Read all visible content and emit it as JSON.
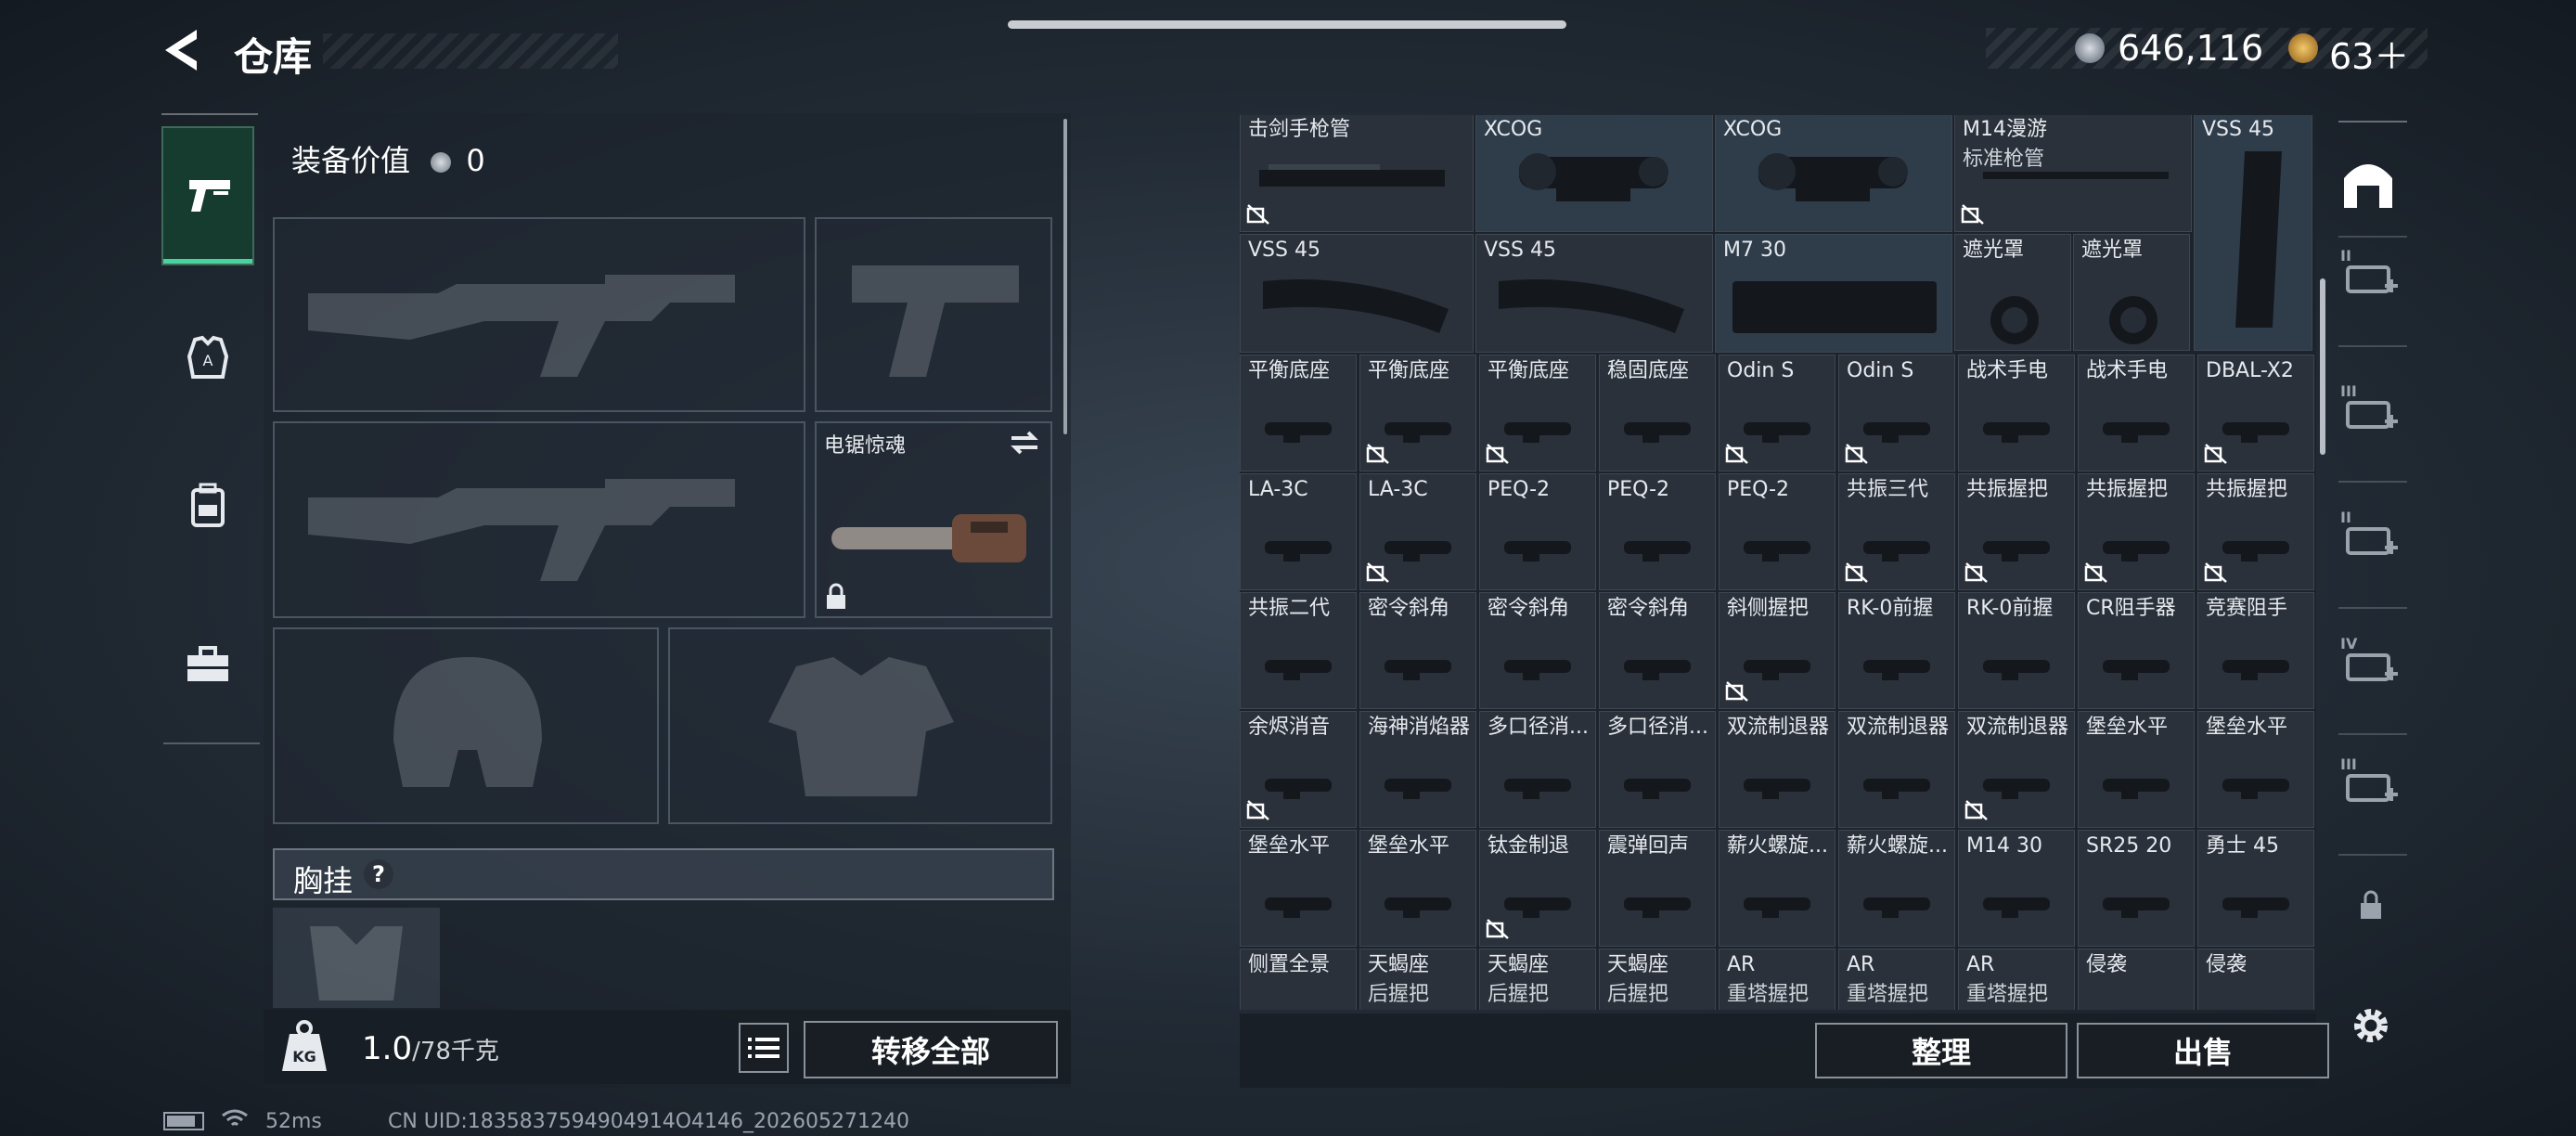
{
  "header": {
    "title": "仓库",
    "currency_1": "646,116",
    "currency_2": "63＋"
  },
  "left_tabs": [
    {
      "icon": "pistol-icon",
      "active": true
    },
    {
      "icon": "vest-icon",
      "active": false
    },
    {
      "icon": "backpack-icon",
      "active": false
    },
    {
      "icon": "toolbox-icon",
      "active": false
    }
  ],
  "loadout": {
    "equip_value_label": "装备价值",
    "equip_value": "0",
    "melee_slot_label": "电锯惊魂",
    "chest_rig_label": "胸挂",
    "chest_rig_help": "?",
    "weight_current": "1.0",
    "weight_max": "/78千克",
    "transfer_all": "转移全部"
  },
  "storage": {
    "top_row": [
      {
        "line1": "击剑手枪管",
        "line2": "",
        "tradeable": false
      },
      {
        "line1": "XCOG",
        "line2": "",
        "tradeable": true
      },
      {
        "line1": "XCOG",
        "line2": "",
        "tradeable": true
      },
      {
        "line1": "M14漫游",
        "line2": "标准枪管",
        "tradeable": false
      },
      {
        "line1": "VSS 45",
        "line2": "",
        "tradeable": true
      }
    ],
    "mag_row": [
      {
        "line1": "VSS 45"
      },
      {
        "line1": "VSS 45"
      },
      {
        "line1": "M7 30"
      },
      {
        "line1": "遮光罩"
      },
      {
        "line1": "遮光罩"
      }
    ],
    "rows": [
      [
        {
          "line1": "平衡底座",
          "line2": "",
          "tradeable": true
        },
        {
          "line1": "平衡底座",
          "line2": "",
          "tradeable": false
        },
        {
          "line1": "平衡底座",
          "line2": "",
          "tradeable": false
        },
        {
          "line1": "稳固底座",
          "line2": "",
          "tradeable": true
        },
        {
          "line1": "Odin S",
          "line2": "",
          "tradeable": false
        },
        {
          "line1": "Odin S",
          "line2": "",
          "tradeable": false
        },
        {
          "line1": "战术手电",
          "line2": "",
          "tradeable": true
        },
        {
          "line1": "战术手电",
          "line2": "",
          "tradeable": true
        },
        {
          "line1": "DBAL-X2",
          "line2": "",
          "tradeable": false
        }
      ],
      [
        {
          "line1": "LA-3C",
          "line2": "",
          "tradeable": true
        },
        {
          "line1": "LA-3C",
          "line2": "",
          "tradeable": false
        },
        {
          "line1": "PEQ-2",
          "line2": "",
          "tradeable": true
        },
        {
          "line1": "PEQ-2",
          "line2": "",
          "tradeable": true
        },
        {
          "line1": "PEQ-2",
          "line2": "",
          "tradeable": true
        },
        {
          "line1": "共振三代",
          "line2": "",
          "tradeable": false
        },
        {
          "line1": "共振握把",
          "line2": "",
          "tradeable": false
        },
        {
          "line1": "共振握把",
          "line2": "",
          "tradeable": false
        },
        {
          "line1": "共振握把",
          "line2": "",
          "tradeable": false
        }
      ],
      [
        {
          "line1": "共振二代",
          "line2": "",
          "tradeable": true
        },
        {
          "line1": "密令斜角",
          "line2": "",
          "tradeable": true
        },
        {
          "line1": "密令斜角",
          "line2": "",
          "tradeable": true
        },
        {
          "line1": "密令斜角",
          "line2": "",
          "tradeable": true
        },
        {
          "line1": "斜侧握把",
          "line2": "",
          "tradeable": false
        },
        {
          "line1": "RK-0前握",
          "line2": "",
          "tradeable": true
        },
        {
          "line1": "RK-0前握",
          "line2": "",
          "tradeable": true
        },
        {
          "line1": "CR阻手器",
          "line2": "",
          "tradeable": true
        },
        {
          "line1": "竞赛阻手",
          "line2": "",
          "tradeable": true
        }
      ],
      [
        {
          "line1": "余烬消音",
          "line2": "",
          "tradeable": false
        },
        {
          "line1": "海神消焰器",
          "line2": "",
          "tradeable": true
        },
        {
          "line1": "多口径消...",
          "line2": "",
          "tradeable": true
        },
        {
          "line1": "多口径消...",
          "line2": "",
          "tradeable": true
        },
        {
          "line1": "双流制退器",
          "line2": "",
          "tradeable": true
        },
        {
          "line1": "双流制退器",
          "line2": "",
          "tradeable": true
        },
        {
          "line1": "双流制退器",
          "line2": "",
          "tradeable": false
        },
        {
          "line1": "堡垒水平",
          "line2": "",
          "tradeable": true
        },
        {
          "line1": "堡垒水平",
          "line2": "",
          "tradeable": true
        }
      ],
      [
        {
          "line1": "堡垒水平",
          "line2": "",
          "tradeable": true
        },
        {
          "line1": "堡垒水平",
          "line2": "",
          "tradeable": true
        },
        {
          "line1": "钛金制退",
          "line2": "",
          "tradeable": false
        },
        {
          "line1": "震弹回声",
          "line2": "",
          "tradeable": true
        },
        {
          "line1": "薪火螺旋...",
          "line2": "",
          "tradeable": true
        },
        {
          "line1": "薪火螺旋...",
          "line2": "",
          "tradeable": true
        },
        {
          "line1": "M14 30",
          "line2": "",
          "tradeable": true
        },
        {
          "line1": "SR25 20",
          "line2": "",
          "tradeable": true
        },
        {
          "line1": "勇士 45",
          "line2": "",
          "tradeable": true
        }
      ],
      [
        {
          "line1": "侧置全景",
          "line2": "",
          "tradeable": true
        },
        {
          "line1": "天蝎座",
          "line2": "后握把",
          "tradeable": true
        },
        {
          "line1": "天蝎座",
          "line2": "后握把",
          "tradeable": true
        },
        {
          "line1": "天蝎座",
          "line2": "后握把",
          "tradeable": true
        },
        {
          "line1": "AR",
          "line2": "重塔握把",
          "tradeable": true
        },
        {
          "line1": "AR",
          "line2": "重塔握把",
          "tradeable": true
        },
        {
          "line1": "AR",
          "line2": "重塔握把",
          "tradeable": true
        },
        {
          "line1": "侵袭",
          "line2": "",
          "tradeable": true
        },
        {
          "line1": "侵袭",
          "line2": "",
          "tradeable": true
        }
      ]
    ],
    "sort_button": "整理",
    "sell_button": "出售"
  },
  "right_tabs": [
    {
      "icon": "storage-arch-icon",
      "label": ""
    },
    {
      "icon": "tier-2-gear-icon",
      "label": "II"
    },
    {
      "icon": "tier-3-gun-icon",
      "label": "III"
    },
    {
      "icon": "tier-2-medkit-icon",
      "label": "II"
    },
    {
      "icon": "tier-4-medkit-icon",
      "label": "IV"
    },
    {
      "icon": "tier-3-map-icon",
      "label": "III"
    },
    {
      "icon": "lock-icon",
      "label": ""
    }
  ],
  "status_bar": {
    "ping": "52ms",
    "uid": "CN UID:1835837594904914O4146_202605271240"
  }
}
